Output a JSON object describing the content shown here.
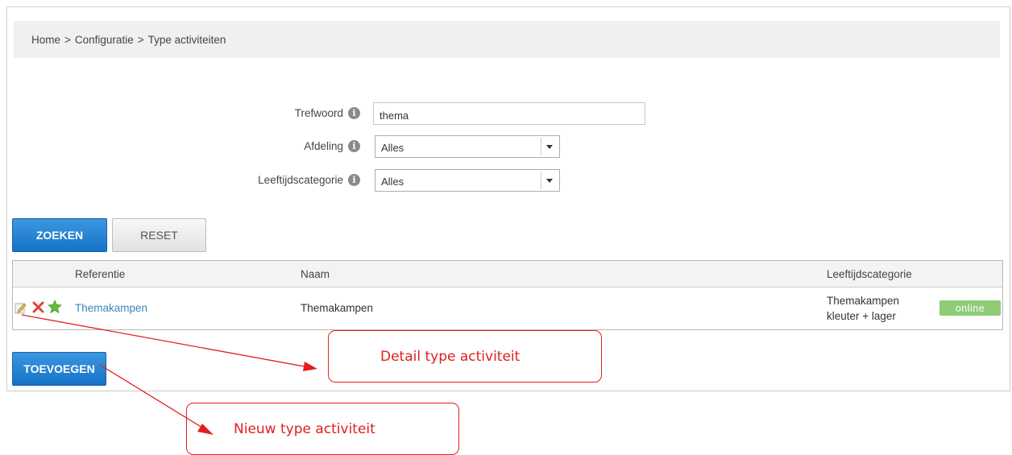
{
  "breadcrumb": {
    "home": "Home",
    "sep": ">",
    "configuratie": "Configuratie",
    "current": "Type activiteiten"
  },
  "filters": {
    "trefwoord_label": "Trefwoord",
    "trefwoord_value": "thema",
    "afdeling_label": "Afdeling",
    "afdeling_value": "Alles",
    "leeftijd_label": "Leeftijdscategorie",
    "leeftijd_value": "Alles",
    "info_glyph": "i"
  },
  "buttons": {
    "search": "ZOEKEN",
    "reset": "RESET",
    "add": "TOEVOEGEN"
  },
  "table": {
    "headers": {
      "referentie": "Referentie",
      "naam": "Naam",
      "leeftijd": "Leeftijdscategorie"
    },
    "rows": [
      {
        "referentie": "Themakampen",
        "naam": "Themakampen",
        "leeftijd_line1": "Themakampen",
        "leeftijd_line2": "kleuter + lager",
        "status": "online"
      }
    ]
  },
  "annotations": {
    "detail": "Detail type activiteit",
    "nieuw": "Nieuw type activiteit"
  },
  "colors": {
    "primary_button": "#1a76c9",
    "link": "#3a87b8",
    "status_online": "#8fcc75",
    "annotation": "#e02020"
  },
  "icons": [
    "edit-icon",
    "delete-icon",
    "star-icon",
    "info-icon",
    "chevron-down-icon"
  ]
}
